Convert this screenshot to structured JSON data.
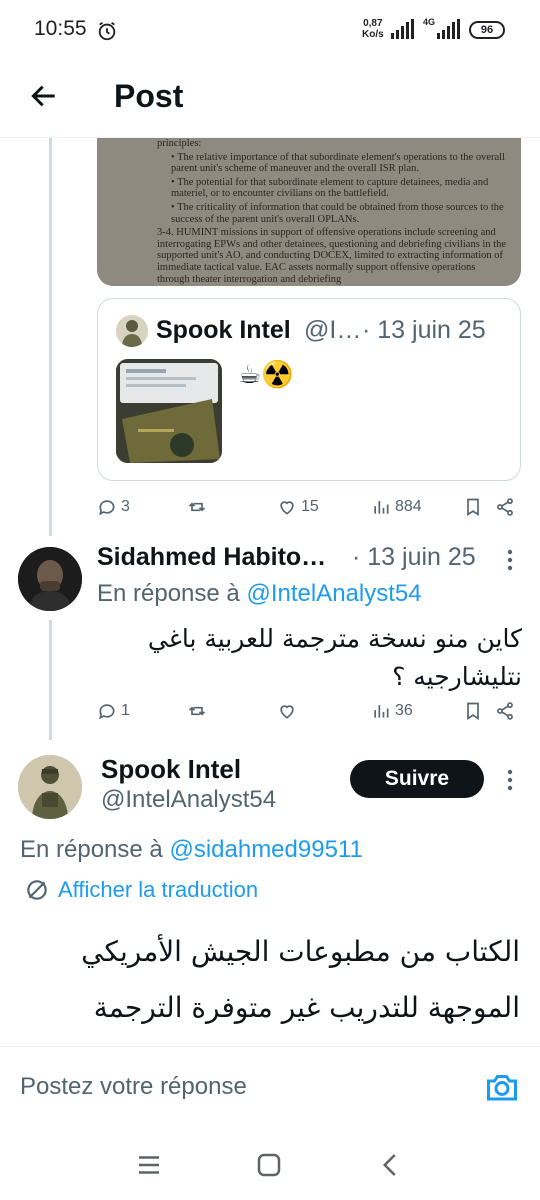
{
  "status_bar": {
    "time": "10:55",
    "net_speed_value": "0,87",
    "net_speed_unit": "Ko/s",
    "network_type": "4G",
    "battery": "96"
  },
  "header": {
    "title": "Post"
  },
  "document_image": {
    "lines": [
      "principles:",
      "• The relative importance of that subordinate element's operations to the overall parent unit's scheme of maneuver and the overall ISR plan.",
      "• The potential for that subordinate element to capture detainees, media and materiel, or to encounter civilians on the battlefield.",
      "• The criticality of information that could be obtained from those sources to the success of the parent unit's overall OPLANs.",
      "3-4. HUMINT missions in support of offensive operations include screening and interrogating EPWs and other detainees, questioning and debriefing civilians in the supported unit's AO, and conducting DOCEX, limited to extracting information of immediate tactical value. EAC assets normally support offensive operations through theater interrogation and debriefing"
    ]
  },
  "quoted_post": {
    "author": "Spook Intel",
    "handle": "@I…",
    "date": "· 13 juin 25",
    "text": "☕☢️"
  },
  "post_actions": {
    "replies": "3",
    "likes": "15",
    "views": "884"
  },
  "reply": {
    "author": "Sidahmed Habito…",
    "date": "· 13 juin 25",
    "replying_prefix": "En réponse à",
    "replying_to": "@IntelAnalyst54",
    "text_line1": "كاين منو نسخة مترجمة للعربية باغي",
    "text_line2": "نتليشارجيه ؟",
    "replies": "1",
    "views": "36"
  },
  "main_post": {
    "author": "Spook Intel",
    "handle": "@IntelAnalyst54",
    "follow_label": "Suivre",
    "replying_prefix": "En réponse à",
    "replying_to": "@sidahmed99511",
    "translate_label": "Afficher la traduction",
    "text_line1": "الكتاب من مطبوعات الجيش الأمريكي",
    "text_line2": "الموجهة للتدريب غير متوفرة الترجمة"
  },
  "compose": {
    "placeholder": "Postez votre réponse"
  },
  "colors": {
    "accent": "#1d9bf0",
    "text": "#0f1419",
    "muted": "#536471",
    "border": "#cfd9de"
  }
}
